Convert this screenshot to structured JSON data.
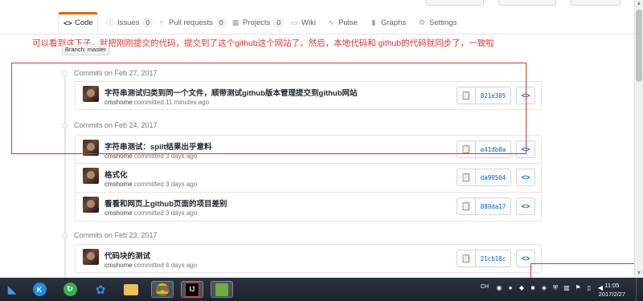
{
  "tabs": [
    {
      "label": "Code",
      "icon": "code-icon",
      "selected": true
    },
    {
      "label": "Issues",
      "icon": "issue-icon",
      "count": "0"
    },
    {
      "label": "Pull requests",
      "icon": "pull-request-icon",
      "count": "0"
    },
    {
      "label": "Projects",
      "icon": "project-icon",
      "count": "0"
    },
    {
      "label": "Wiki",
      "icon": "book-icon"
    },
    {
      "label": "Pulse",
      "icon": "pulse-icon"
    },
    {
      "label": "Graphs",
      "icon": "graph-icon"
    },
    {
      "label": "Settings",
      "icon": "gear-icon"
    }
  ],
  "annotation": "可以看到这下子，就把刚刚提交的代码，提交到了这个github这个网站了。然后，本地代码和 github的代码就同步了，一致啦",
  "branch_partial": "Branch: master",
  "groups": [
    {
      "date": "Commits on Feb 27, 2017",
      "commits": [
        {
          "title": "字符串测试归类到同一个文件，顺带测试github版本管理提交到github网站",
          "author": "cmshome",
          "meta": "committed 11 minutes ago",
          "sha": "821e305"
        }
      ]
    },
    {
      "date": "Commits on Feb 24, 2017",
      "commits": [
        {
          "title": "字符串测试：spilt结果出乎意料",
          "author": "cmshome",
          "meta": "committed 3 days ago",
          "sha": "e41db0a"
        },
        {
          "title": "格式化",
          "author": "cmshome",
          "meta": "committed 3 days ago",
          "sha": "da99504"
        },
        {
          "title": "看看和网页上github页面的项目差别",
          "author": "cmshome",
          "meta": "committed 3 days ago",
          "sha": "889da17"
        }
      ]
    },
    {
      "date": "Commits on Feb 23, 2017",
      "commits": [
        {
          "title": "代码块的测试",
          "author": "cmshome",
          "meta": "committed 4 days ago",
          "sha": "21cb18c"
        }
      ]
    }
  ],
  "taskbar": {
    "apps": [
      "start-icon",
      "k-app-icon",
      "refresh-app-icon",
      "cloud-app-icon",
      "file-explorer-icon",
      "chrome-icon",
      "intellij-idea-icon",
      "image-viewer-icon"
    ],
    "tray_lang": "CH",
    "time": "11:05",
    "date": "2017/2/27"
  },
  "colors": {
    "accent_tab": "#e36209",
    "annotation_red": "#e8302c",
    "sha_link": "#0366d6"
  }
}
